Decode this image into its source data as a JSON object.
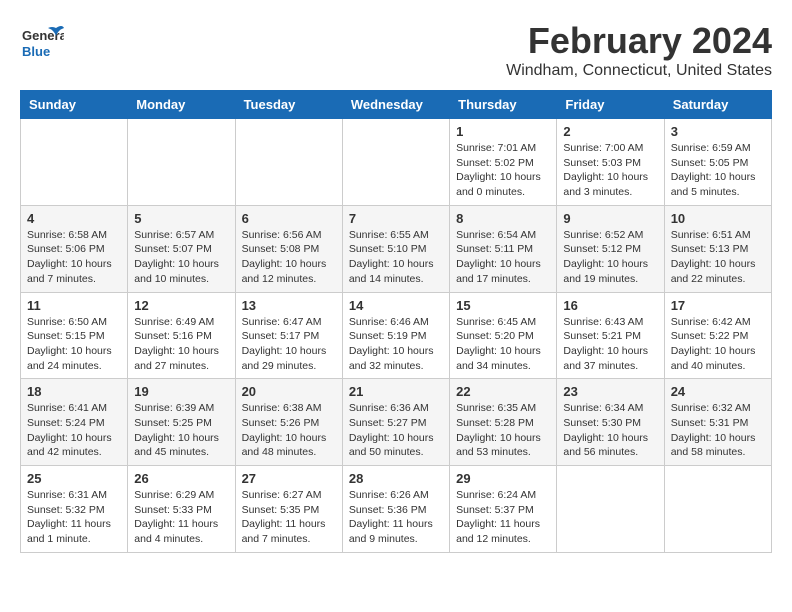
{
  "header": {
    "logo_line1": "General",
    "logo_line2": "Blue",
    "month_year": "February 2024",
    "location": "Windham, Connecticut, United States"
  },
  "weekdays": [
    "Sunday",
    "Monday",
    "Tuesday",
    "Wednesday",
    "Thursday",
    "Friday",
    "Saturday"
  ],
  "weeks": [
    [
      {
        "day": "",
        "info": ""
      },
      {
        "day": "",
        "info": ""
      },
      {
        "day": "",
        "info": ""
      },
      {
        "day": "",
        "info": ""
      },
      {
        "day": "1",
        "info": "Sunrise: 7:01 AM\nSunset: 5:02 PM\nDaylight: 10 hours\nand 0 minutes."
      },
      {
        "day": "2",
        "info": "Sunrise: 7:00 AM\nSunset: 5:03 PM\nDaylight: 10 hours\nand 3 minutes."
      },
      {
        "day": "3",
        "info": "Sunrise: 6:59 AM\nSunset: 5:05 PM\nDaylight: 10 hours\nand 5 minutes."
      }
    ],
    [
      {
        "day": "4",
        "info": "Sunrise: 6:58 AM\nSunset: 5:06 PM\nDaylight: 10 hours\nand 7 minutes."
      },
      {
        "day": "5",
        "info": "Sunrise: 6:57 AM\nSunset: 5:07 PM\nDaylight: 10 hours\nand 10 minutes."
      },
      {
        "day": "6",
        "info": "Sunrise: 6:56 AM\nSunset: 5:08 PM\nDaylight: 10 hours\nand 12 minutes."
      },
      {
        "day": "7",
        "info": "Sunrise: 6:55 AM\nSunset: 5:10 PM\nDaylight: 10 hours\nand 14 minutes."
      },
      {
        "day": "8",
        "info": "Sunrise: 6:54 AM\nSunset: 5:11 PM\nDaylight: 10 hours\nand 17 minutes."
      },
      {
        "day": "9",
        "info": "Sunrise: 6:52 AM\nSunset: 5:12 PM\nDaylight: 10 hours\nand 19 minutes."
      },
      {
        "day": "10",
        "info": "Sunrise: 6:51 AM\nSunset: 5:13 PM\nDaylight: 10 hours\nand 22 minutes."
      }
    ],
    [
      {
        "day": "11",
        "info": "Sunrise: 6:50 AM\nSunset: 5:15 PM\nDaylight: 10 hours\nand 24 minutes."
      },
      {
        "day": "12",
        "info": "Sunrise: 6:49 AM\nSunset: 5:16 PM\nDaylight: 10 hours\nand 27 minutes."
      },
      {
        "day": "13",
        "info": "Sunrise: 6:47 AM\nSunset: 5:17 PM\nDaylight: 10 hours\nand 29 minutes."
      },
      {
        "day": "14",
        "info": "Sunrise: 6:46 AM\nSunset: 5:19 PM\nDaylight: 10 hours\nand 32 minutes."
      },
      {
        "day": "15",
        "info": "Sunrise: 6:45 AM\nSunset: 5:20 PM\nDaylight: 10 hours\nand 34 minutes."
      },
      {
        "day": "16",
        "info": "Sunrise: 6:43 AM\nSunset: 5:21 PM\nDaylight: 10 hours\nand 37 minutes."
      },
      {
        "day": "17",
        "info": "Sunrise: 6:42 AM\nSunset: 5:22 PM\nDaylight: 10 hours\nand 40 minutes."
      }
    ],
    [
      {
        "day": "18",
        "info": "Sunrise: 6:41 AM\nSunset: 5:24 PM\nDaylight: 10 hours\nand 42 minutes."
      },
      {
        "day": "19",
        "info": "Sunrise: 6:39 AM\nSunset: 5:25 PM\nDaylight: 10 hours\nand 45 minutes."
      },
      {
        "day": "20",
        "info": "Sunrise: 6:38 AM\nSunset: 5:26 PM\nDaylight: 10 hours\nand 48 minutes."
      },
      {
        "day": "21",
        "info": "Sunrise: 6:36 AM\nSunset: 5:27 PM\nDaylight: 10 hours\nand 50 minutes."
      },
      {
        "day": "22",
        "info": "Sunrise: 6:35 AM\nSunset: 5:28 PM\nDaylight: 10 hours\nand 53 minutes."
      },
      {
        "day": "23",
        "info": "Sunrise: 6:34 AM\nSunset: 5:30 PM\nDaylight: 10 hours\nand 56 minutes."
      },
      {
        "day": "24",
        "info": "Sunrise: 6:32 AM\nSunset: 5:31 PM\nDaylight: 10 hours\nand 58 minutes."
      }
    ],
    [
      {
        "day": "25",
        "info": "Sunrise: 6:31 AM\nSunset: 5:32 PM\nDaylight: 11 hours\nand 1 minute."
      },
      {
        "day": "26",
        "info": "Sunrise: 6:29 AM\nSunset: 5:33 PM\nDaylight: 11 hours\nand 4 minutes."
      },
      {
        "day": "27",
        "info": "Sunrise: 6:27 AM\nSunset: 5:35 PM\nDaylight: 11 hours\nand 7 minutes."
      },
      {
        "day": "28",
        "info": "Sunrise: 6:26 AM\nSunset: 5:36 PM\nDaylight: 11 hours\nand 9 minutes."
      },
      {
        "day": "29",
        "info": "Sunrise: 6:24 AM\nSunset: 5:37 PM\nDaylight: 11 hours\nand 12 minutes."
      },
      {
        "day": "",
        "info": ""
      },
      {
        "day": "",
        "info": ""
      }
    ]
  ],
  "row_classes": [
    "row-white",
    "row-gray",
    "row-white",
    "row-gray",
    "row-white"
  ]
}
